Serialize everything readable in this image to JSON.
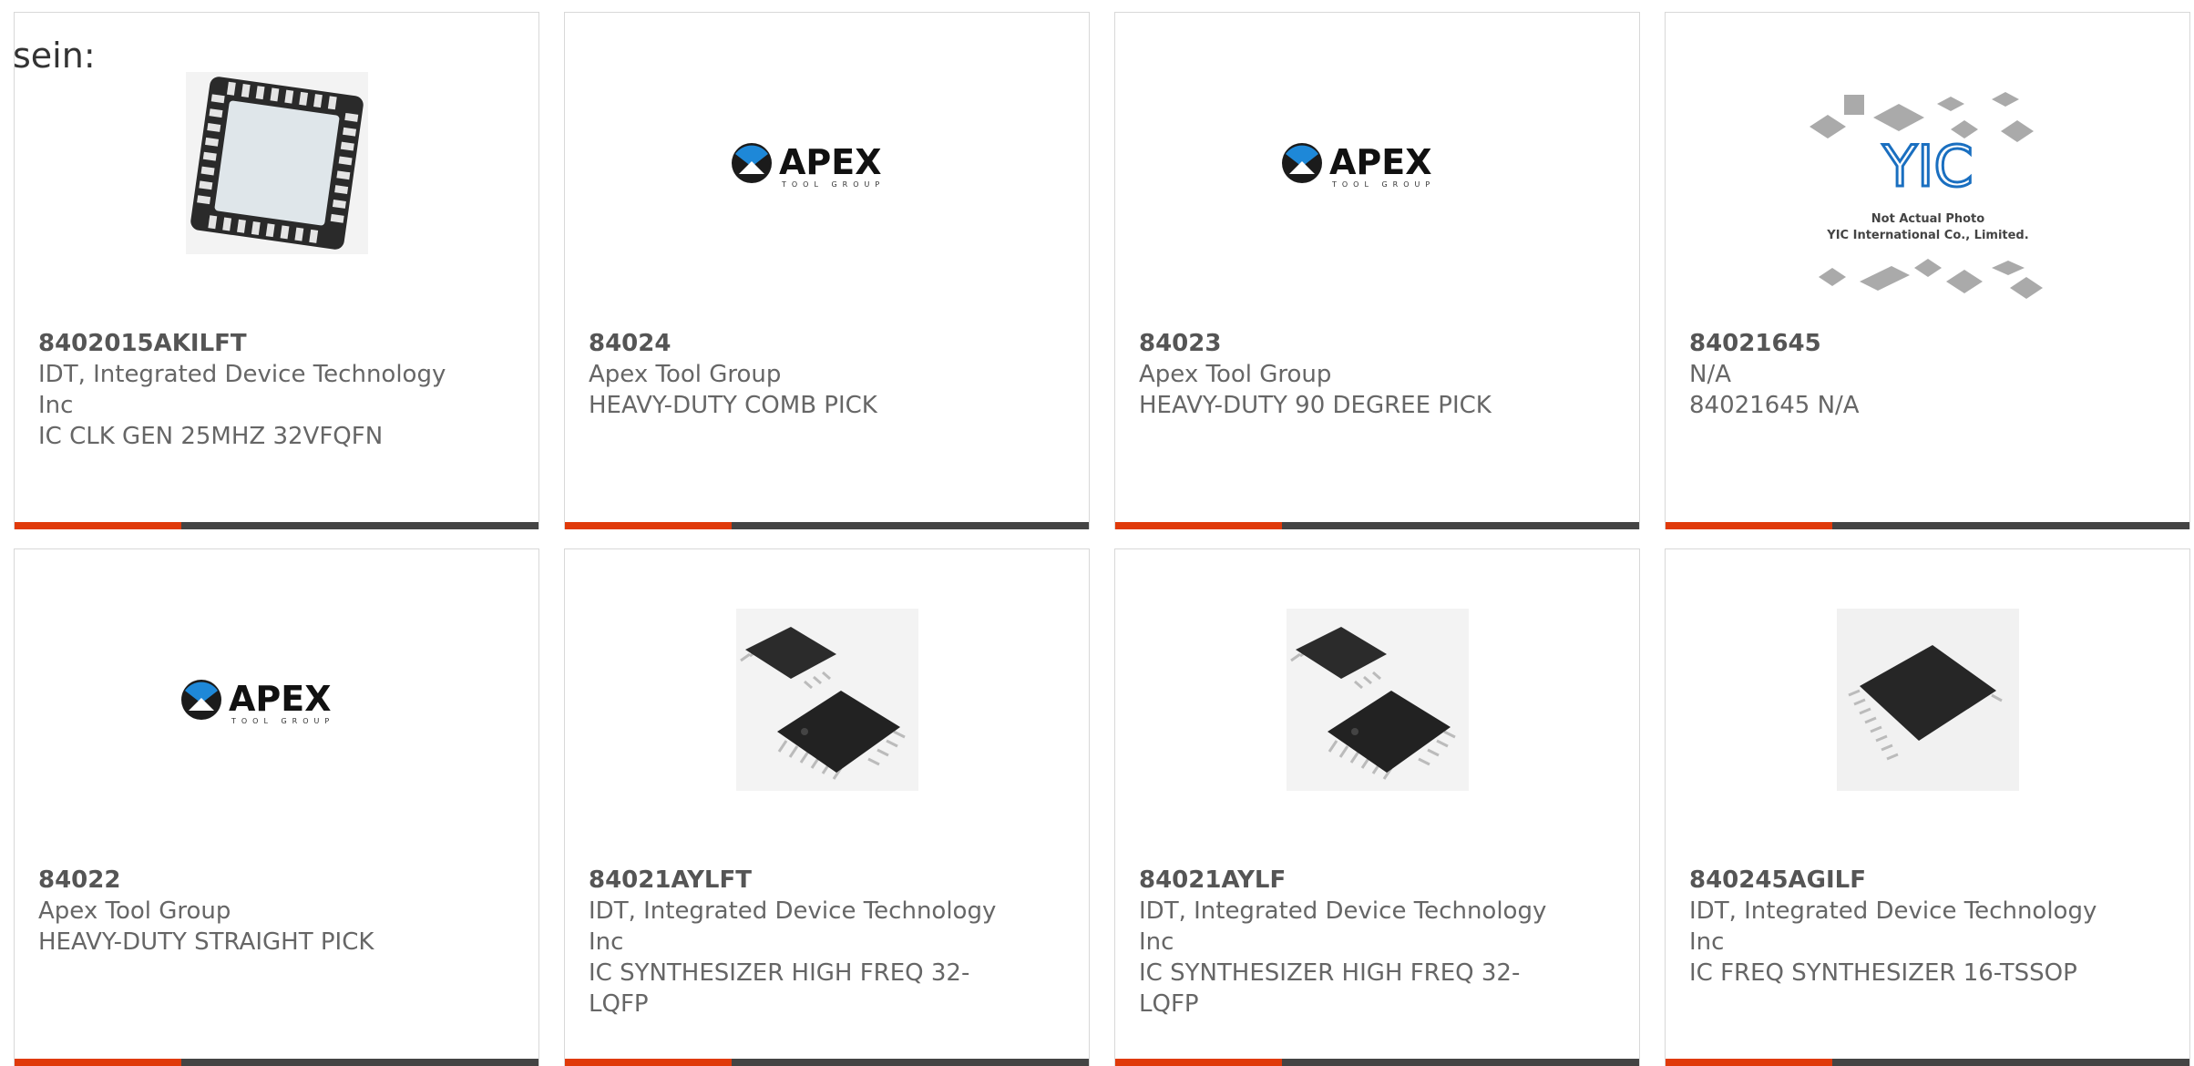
{
  "page": {
    "prefix_text": "sein:",
    "accent_color": "#e03a0a",
    "bar_color": "#444444"
  },
  "products": [
    {
      "part_number": "8402015AKILFT",
      "manufacturer": "IDT, Integrated Device Technology Inc",
      "description": "IC CLK GEN 25MHZ 32VFQFN",
      "image": "qfn-chip-image"
    },
    {
      "part_number": "84024",
      "manufacturer": "Apex Tool Group",
      "description": "HEAVY-DUTY COMB PICK",
      "image": "apex-tool-group-logo"
    },
    {
      "part_number": "84023",
      "manufacturer": "Apex Tool Group",
      "description": "HEAVY-DUTY 90 DEGREE PICK",
      "image": "apex-tool-group-logo"
    },
    {
      "part_number": "84021645",
      "manufacturer": "N/A",
      "description": "84021645 N/A",
      "image": "yic-placeholder-image",
      "image_text": [
        "Not Actual Photo",
        "YIC International Co., Limited."
      ]
    },
    {
      "part_number": "84022",
      "manufacturer": "Apex Tool Group",
      "description": "HEAVY-DUTY STRAIGHT PICK",
      "image": "apex-tool-group-logo"
    },
    {
      "part_number": "84021AYLFT",
      "manufacturer": "IDT, Integrated Device Technology Inc",
      "description": "IC SYNTHESIZER HIGH FREQ 32-LQFP",
      "image": "lqfp-chip-image"
    },
    {
      "part_number": "84021AYLF",
      "manufacturer": "IDT, Integrated Device Technology Inc",
      "description": "IC SYNTHESIZER HIGH FREQ 32-LQFP",
      "image": "lqfp-chip-image"
    },
    {
      "part_number": "840245AGILF",
      "manufacturer": "IDT, Integrated Device Technology Inc",
      "description": "IC FREQ SYNTHESIZER 16-TSSOP",
      "image": "tssop-chip-image"
    }
  ]
}
